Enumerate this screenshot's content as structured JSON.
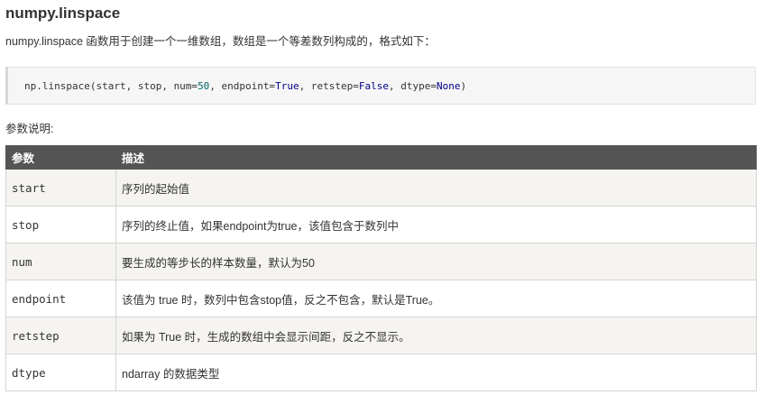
{
  "title": "numpy.linspace",
  "intro": "numpy.linspace 函数用于创建一个一维数组，数组是一个等差数列构成的，格式如下：",
  "code": {
    "prefix": "np.linspace(start, stop, num=",
    "num_value": "50",
    "mid1": ", endpoint=",
    "endpoint_value": "True",
    "mid2": ", retstep=",
    "retstep_value": "False",
    "mid3": ", dtype=",
    "dtype_value": "None",
    "suffix": ")"
  },
  "params_label": "参数说明:",
  "table": {
    "headers": [
      "参数",
      "描述"
    ],
    "rows": [
      {
        "name": "start",
        "desc": "序列的起始值"
      },
      {
        "name": "stop",
        "desc": "序列的终止值，如果endpoint为true，该值包含于数列中"
      },
      {
        "name": "num",
        "desc": "要生成的等步长的样本数量，默认为50"
      },
      {
        "name": "endpoint",
        "desc": "该值为 true 时，数列中包含stop值，反之不包含，默认是True。"
      },
      {
        "name": "retstep",
        "desc": "如果为 True 时，生成的数组中会显示间距，反之不显示。"
      },
      {
        "name": "dtype",
        "desc": "ndarray 的数据类型"
      }
    ]
  }
}
